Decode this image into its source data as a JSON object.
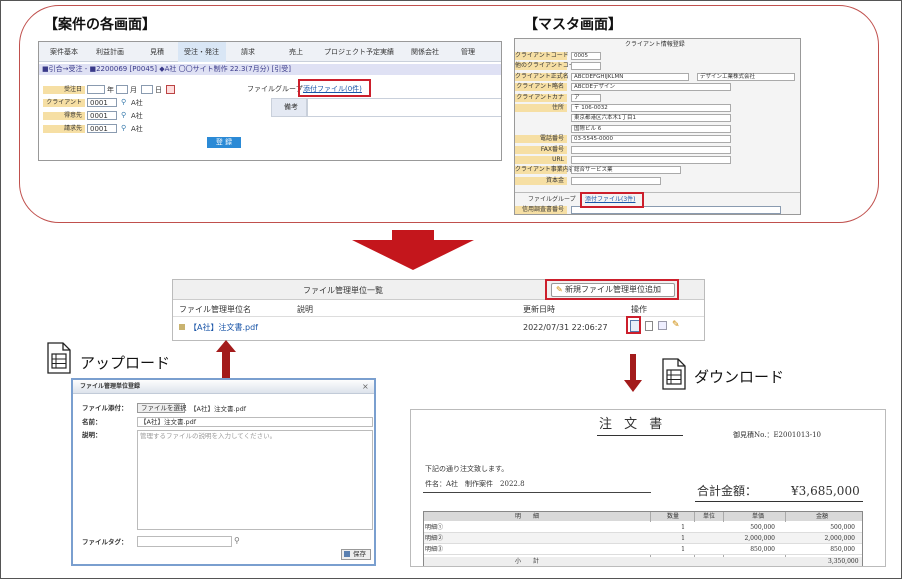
{
  "case_screen": {
    "heading": "【案件の各画面】",
    "tabs": [
      "案件基本",
      "利益計画",
      "見積",
      "受注・発注",
      "請求",
      "売上",
      "プロジェクト予定実績",
      "関係会社",
      "管理"
    ],
    "info": "■引合→受注 - ■2200069 [P0045] ◆A社 〇〇サイト制作 22.3(7月分) [引受]",
    "fields": [
      {
        "label": "受注日",
        "value": "",
        "year": "年",
        "month": "月",
        "day": "日"
      },
      {
        "label": "クライアント",
        "value": "0001",
        "suffix": "A社"
      },
      {
        "label": "得意先",
        "value": "0001",
        "suffix": "A社"
      },
      {
        "label": "請求先",
        "value": "0001",
        "suffix": "A社"
      }
    ],
    "file_group_label": "ファイルグループ",
    "attach_link": "添付ファイル(0件)",
    "remarks_label": "備考",
    "register_button": "登 録"
  },
  "master_screen": {
    "heading": "【マスタ画面】",
    "title": "クライアント情報登録",
    "rows": [
      {
        "label": "クライアントコード",
        "value": "0005"
      },
      {
        "label": "他のクライアントコード",
        "value": ""
      },
      {
        "label": "クライアント正式名",
        "value": "ABCDEFGHIJKLMN",
        "extra": "デザイン工業株式会社"
      },
      {
        "label": "クライアント略名",
        "value": "ABCDEデザイン"
      },
      {
        "label": "クライアントカナ",
        "value": "ア"
      },
      {
        "label": "住所",
        "value": "〒 106-0032"
      },
      {
        "label": "",
        "value": "東京都港区六本木1丁目1"
      },
      {
        "label": "",
        "value": "国際ビル 6"
      },
      {
        "label": "電話番号",
        "value": "03-5545-0000"
      },
      {
        "label": "FAX番号",
        "value": ""
      },
      {
        "label": "URL",
        "value": ""
      },
      {
        "label": "クライアント事業内容",
        "value": "総合サービス業"
      },
      {
        "label": "資本金",
        "value": ""
      }
    ],
    "file_group_label": "ファイルグループ",
    "attach_link": "添付ファイル(3件)",
    "last_label": "信用調査書番号"
  },
  "file_list": {
    "title": "ファイル管理単位一覧",
    "add_button": "新規ファイル管理単位追加",
    "headers": [
      "ファイル管理単位名",
      "説明",
      "更新日時",
      "操作"
    ],
    "row": {
      "name": "【A社】注文書.pdf",
      "description": "",
      "updated": "2022/07/31 22:06:27"
    }
  },
  "upload": {
    "label": "アップロード",
    "dialog_title": "ファイル管理単位登録",
    "file_label": "ファイル添付：",
    "choose_button": "ファイルを選択",
    "chosen_file": "【A社】注文書.pdf",
    "name_label": "名前：",
    "name_value": "【A社】注文書.pdf",
    "desc_label": "説明：",
    "desc_placeholder": "管理するファイルの説明を入力してください。",
    "tag_label": "ファイルタグ：",
    "save_button": "保存",
    "close": "×"
  },
  "download": {
    "label": "ダウンロード",
    "doc_title": "注 文 書",
    "quote_no": "御見積No.：E2001013-10",
    "intro": "下記の通り注文致します。",
    "subject": "件名：A社　制作案件　2022.8",
    "total_label": "合計金額：",
    "total_value": "¥3,685,000",
    "table_headers": [
      "明　　細",
      "数量",
      "単位",
      "単価",
      "金額"
    ],
    "table_rows": [
      {
        "item": "明細①",
        "qty": "1",
        "unit": "",
        "price": "500,000",
        "amount": "500,000"
      },
      {
        "item": "明細②",
        "qty": "1",
        "unit": "",
        "price": "2,000,000",
        "amount": "2,000,000"
      },
      {
        "item": "明細③",
        "qty": "1",
        "unit": "",
        "price": "850,000",
        "amount": "850,000"
      }
    ],
    "subtotal_label": "小　　計",
    "subtotal_value": "3,350,000"
  }
}
